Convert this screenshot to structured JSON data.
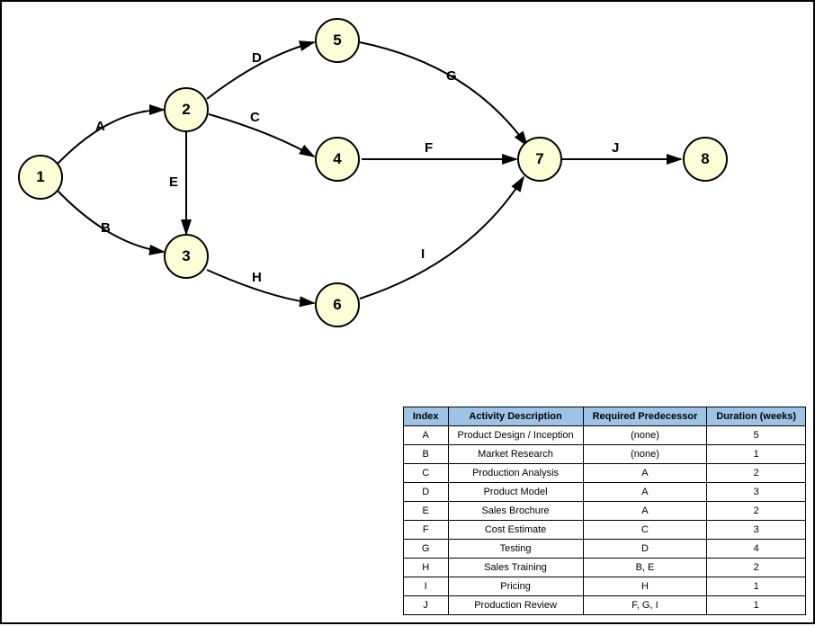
{
  "nodes": {
    "n1": "1",
    "n2": "2",
    "n3": "3",
    "n4": "4",
    "n5": "5",
    "n6": "6",
    "n7": "7",
    "n8": "8"
  },
  "edges": {
    "eA": "A",
    "eB": "B",
    "eC": "C",
    "eD": "D",
    "eE": "E",
    "eF": "F",
    "eG": "G",
    "eH": "H",
    "eI": "I",
    "eJ": "J"
  },
  "table": {
    "headers": {
      "col1": "Index",
      "col2": "Activity Description",
      "col3": "Required Predecessor",
      "col4": "Duration (weeks)"
    },
    "rows": [
      {
        "index": "A",
        "desc": "Product Design / Inception",
        "pred": "(none)",
        "dur": "5"
      },
      {
        "index": "B",
        "desc": "Market Research",
        "pred": "(none)",
        "dur": "1"
      },
      {
        "index": "C",
        "desc": "Production Analysis",
        "pred": "A",
        "dur": "2"
      },
      {
        "index": "D",
        "desc": "Product Model",
        "pred": "A",
        "dur": "3"
      },
      {
        "index": "E",
        "desc": "Sales Brochure",
        "pred": "A",
        "dur": "2"
      },
      {
        "index": "F",
        "desc": "Cost Estimate",
        "pred": "C",
        "dur": "3"
      },
      {
        "index": "G",
        "desc": "Testing",
        "pred": "D",
        "dur": "4"
      },
      {
        "index": "H",
        "desc": "Sales Training",
        "pred": "B, E",
        "dur": "2"
      },
      {
        "index": "I",
        "desc": "Pricing",
        "pred": "H",
        "dur": "1"
      },
      {
        "index": "J",
        "desc": "Production Review",
        "pred": "F, G, I",
        "dur": "1"
      }
    ]
  }
}
